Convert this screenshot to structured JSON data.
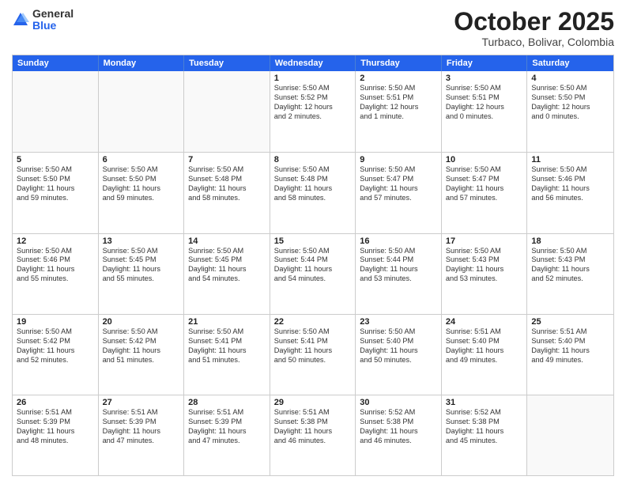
{
  "header": {
    "logo": {
      "general": "General",
      "blue": "Blue"
    },
    "title": "October 2025",
    "location": "Turbaco, Bolivar, Colombia"
  },
  "weekdays": [
    "Sunday",
    "Monday",
    "Tuesday",
    "Wednesday",
    "Thursday",
    "Friday",
    "Saturday"
  ],
  "rows": [
    [
      {
        "day": "",
        "lines": []
      },
      {
        "day": "",
        "lines": []
      },
      {
        "day": "",
        "lines": []
      },
      {
        "day": "1",
        "lines": [
          "Sunrise: 5:50 AM",
          "Sunset: 5:52 PM",
          "Daylight: 12 hours",
          "and 2 minutes."
        ]
      },
      {
        "day": "2",
        "lines": [
          "Sunrise: 5:50 AM",
          "Sunset: 5:51 PM",
          "Daylight: 12 hours",
          "and 1 minute."
        ]
      },
      {
        "day": "3",
        "lines": [
          "Sunrise: 5:50 AM",
          "Sunset: 5:51 PM",
          "Daylight: 12 hours",
          "and 0 minutes."
        ]
      },
      {
        "day": "4",
        "lines": [
          "Sunrise: 5:50 AM",
          "Sunset: 5:50 PM",
          "Daylight: 12 hours",
          "and 0 minutes."
        ]
      }
    ],
    [
      {
        "day": "5",
        "lines": [
          "Sunrise: 5:50 AM",
          "Sunset: 5:50 PM",
          "Daylight: 11 hours",
          "and 59 minutes."
        ]
      },
      {
        "day": "6",
        "lines": [
          "Sunrise: 5:50 AM",
          "Sunset: 5:50 PM",
          "Daylight: 11 hours",
          "and 59 minutes."
        ]
      },
      {
        "day": "7",
        "lines": [
          "Sunrise: 5:50 AM",
          "Sunset: 5:48 PM",
          "Daylight: 11 hours",
          "and 58 minutes."
        ]
      },
      {
        "day": "8",
        "lines": [
          "Sunrise: 5:50 AM",
          "Sunset: 5:48 PM",
          "Daylight: 11 hours",
          "and 58 minutes."
        ]
      },
      {
        "day": "9",
        "lines": [
          "Sunrise: 5:50 AM",
          "Sunset: 5:47 PM",
          "Daylight: 11 hours",
          "and 57 minutes."
        ]
      },
      {
        "day": "10",
        "lines": [
          "Sunrise: 5:50 AM",
          "Sunset: 5:47 PM",
          "Daylight: 11 hours",
          "and 57 minutes."
        ]
      },
      {
        "day": "11",
        "lines": [
          "Sunrise: 5:50 AM",
          "Sunset: 5:46 PM",
          "Daylight: 11 hours",
          "and 56 minutes."
        ]
      }
    ],
    [
      {
        "day": "12",
        "lines": [
          "Sunrise: 5:50 AM",
          "Sunset: 5:46 PM",
          "Daylight: 11 hours",
          "and 55 minutes."
        ]
      },
      {
        "day": "13",
        "lines": [
          "Sunrise: 5:50 AM",
          "Sunset: 5:45 PM",
          "Daylight: 11 hours",
          "and 55 minutes."
        ]
      },
      {
        "day": "14",
        "lines": [
          "Sunrise: 5:50 AM",
          "Sunset: 5:45 PM",
          "Daylight: 11 hours",
          "and 54 minutes."
        ]
      },
      {
        "day": "15",
        "lines": [
          "Sunrise: 5:50 AM",
          "Sunset: 5:44 PM",
          "Daylight: 11 hours",
          "and 54 minutes."
        ]
      },
      {
        "day": "16",
        "lines": [
          "Sunrise: 5:50 AM",
          "Sunset: 5:44 PM",
          "Daylight: 11 hours",
          "and 53 minutes."
        ]
      },
      {
        "day": "17",
        "lines": [
          "Sunrise: 5:50 AM",
          "Sunset: 5:43 PM",
          "Daylight: 11 hours",
          "and 53 minutes."
        ]
      },
      {
        "day": "18",
        "lines": [
          "Sunrise: 5:50 AM",
          "Sunset: 5:43 PM",
          "Daylight: 11 hours",
          "and 52 minutes."
        ]
      }
    ],
    [
      {
        "day": "19",
        "lines": [
          "Sunrise: 5:50 AM",
          "Sunset: 5:42 PM",
          "Daylight: 11 hours",
          "and 52 minutes."
        ]
      },
      {
        "day": "20",
        "lines": [
          "Sunrise: 5:50 AM",
          "Sunset: 5:42 PM",
          "Daylight: 11 hours",
          "and 51 minutes."
        ]
      },
      {
        "day": "21",
        "lines": [
          "Sunrise: 5:50 AM",
          "Sunset: 5:41 PM",
          "Daylight: 11 hours",
          "and 51 minutes."
        ]
      },
      {
        "day": "22",
        "lines": [
          "Sunrise: 5:50 AM",
          "Sunset: 5:41 PM",
          "Daylight: 11 hours",
          "and 50 minutes."
        ]
      },
      {
        "day": "23",
        "lines": [
          "Sunrise: 5:50 AM",
          "Sunset: 5:40 PM",
          "Daylight: 11 hours",
          "and 50 minutes."
        ]
      },
      {
        "day": "24",
        "lines": [
          "Sunrise: 5:51 AM",
          "Sunset: 5:40 PM",
          "Daylight: 11 hours",
          "and 49 minutes."
        ]
      },
      {
        "day": "25",
        "lines": [
          "Sunrise: 5:51 AM",
          "Sunset: 5:40 PM",
          "Daylight: 11 hours",
          "and 49 minutes."
        ]
      }
    ],
    [
      {
        "day": "26",
        "lines": [
          "Sunrise: 5:51 AM",
          "Sunset: 5:39 PM",
          "Daylight: 11 hours",
          "and 48 minutes."
        ]
      },
      {
        "day": "27",
        "lines": [
          "Sunrise: 5:51 AM",
          "Sunset: 5:39 PM",
          "Daylight: 11 hours",
          "and 47 minutes."
        ]
      },
      {
        "day": "28",
        "lines": [
          "Sunrise: 5:51 AM",
          "Sunset: 5:39 PM",
          "Daylight: 11 hours",
          "and 47 minutes."
        ]
      },
      {
        "day": "29",
        "lines": [
          "Sunrise: 5:51 AM",
          "Sunset: 5:38 PM",
          "Daylight: 11 hours",
          "and 46 minutes."
        ]
      },
      {
        "day": "30",
        "lines": [
          "Sunrise: 5:52 AM",
          "Sunset: 5:38 PM",
          "Daylight: 11 hours",
          "and 46 minutes."
        ]
      },
      {
        "day": "31",
        "lines": [
          "Sunrise: 5:52 AM",
          "Sunset: 5:38 PM",
          "Daylight: 11 hours",
          "and 45 minutes."
        ]
      },
      {
        "day": "",
        "lines": []
      }
    ]
  ]
}
